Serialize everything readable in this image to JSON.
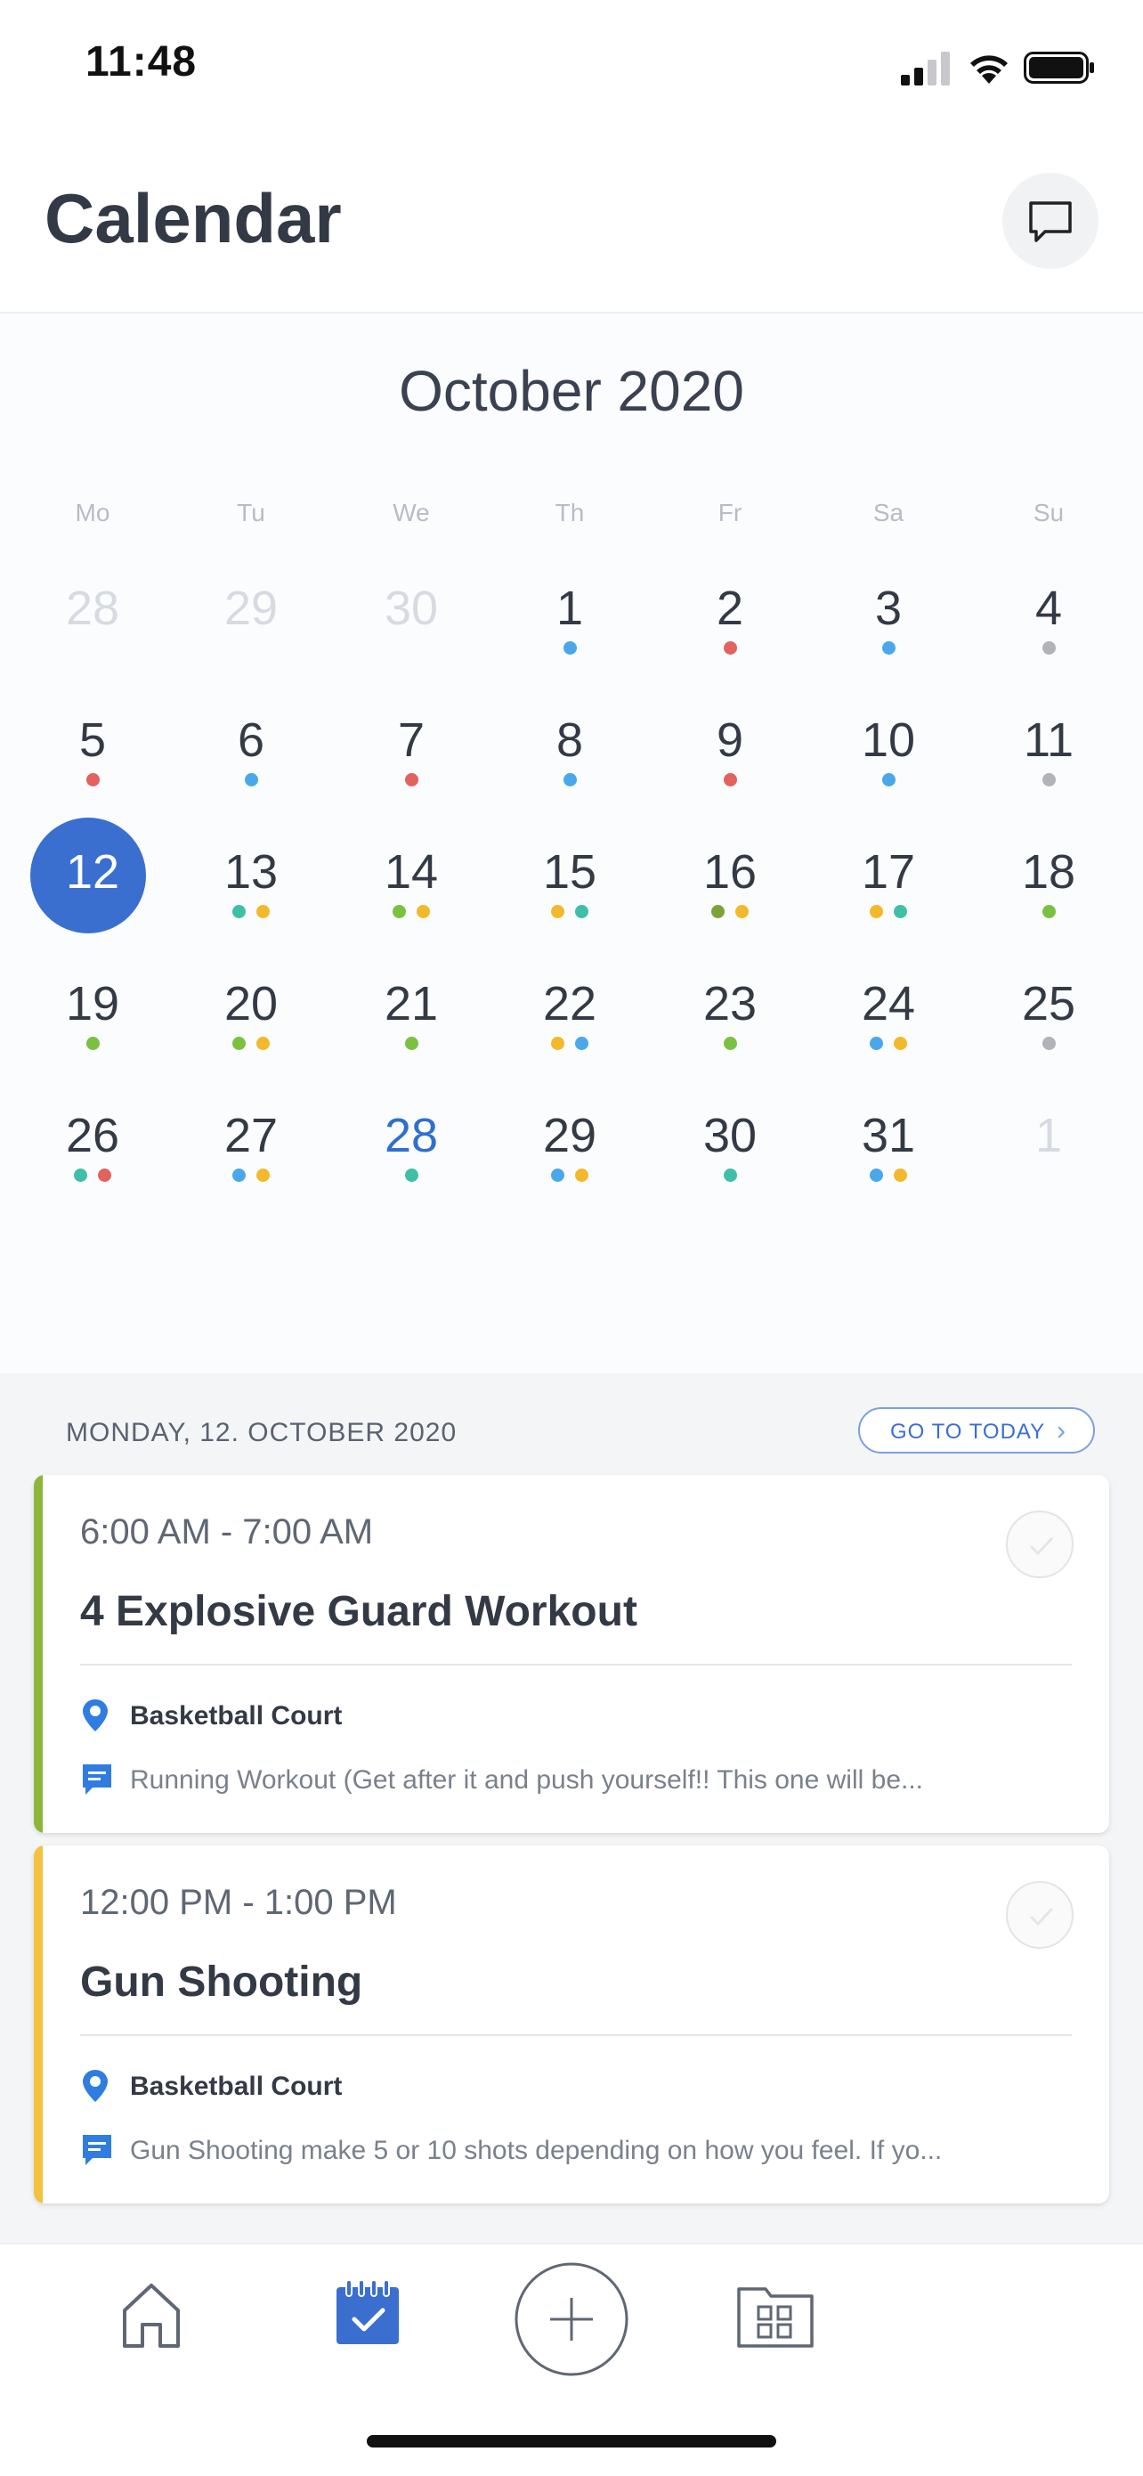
{
  "status_bar": {
    "time": "11:48"
  },
  "header": {
    "title": "Calendar",
    "chat_icon": "chat-bubble-icon"
  },
  "calendar": {
    "month_title": "October 2020",
    "weekdays": [
      "Mo",
      "Tu",
      "We",
      "Th",
      "Fr",
      "Sa",
      "Su"
    ],
    "weeks": [
      [
        {
          "d": "28",
          "muted": true,
          "dots": []
        },
        {
          "d": "29",
          "muted": true,
          "dots": []
        },
        {
          "d": "30",
          "muted": true,
          "dots": []
        },
        {
          "d": "1",
          "dots": [
            "#4aa8ea"
          ]
        },
        {
          "d": "2",
          "dots": [
            "#e2625e"
          ]
        },
        {
          "d": "3",
          "dots": [
            "#4aa8ea"
          ]
        },
        {
          "d": "4",
          "dots": [
            "#b0b3b8"
          ]
        }
      ],
      [
        {
          "d": "5",
          "dots": [
            "#e2625e"
          ]
        },
        {
          "d": "6",
          "dots": [
            "#4aa8ea"
          ]
        },
        {
          "d": "7",
          "dots": [
            "#e2625e"
          ]
        },
        {
          "d": "8",
          "dots": [
            "#4aa8ea"
          ]
        },
        {
          "d": "9",
          "dots": [
            "#e2625e"
          ]
        },
        {
          "d": "10",
          "dots": [
            "#4aa8ea"
          ]
        },
        {
          "d": "11",
          "dots": [
            "#b0b3b8"
          ]
        }
      ],
      [
        {
          "d": "12",
          "selected": true,
          "dots": []
        },
        {
          "d": "13",
          "dots": [
            "#3fbfa8",
            "#f2b92c"
          ]
        },
        {
          "d": "14",
          "dots": [
            "#7ac142",
            "#f2b92c"
          ]
        },
        {
          "d": "15",
          "dots": [
            "#f2b92c",
            "#3fbfa8"
          ]
        },
        {
          "d": "16",
          "dots": [
            "#7ba33a",
            "#f2b92c"
          ]
        },
        {
          "d": "17",
          "dots": [
            "#f2b92c",
            "#3fbfa8"
          ]
        },
        {
          "d": "18",
          "dots": [
            "#7ac142"
          ]
        }
      ],
      [
        {
          "d": "19",
          "dots": [
            "#7ac142"
          ]
        },
        {
          "d": "20",
          "dots": [
            "#7ac142",
            "#f2b92c"
          ]
        },
        {
          "d": "21",
          "dots": [
            "#7ac142"
          ]
        },
        {
          "d": "22",
          "dots": [
            "#f2b92c",
            "#4aa8ea"
          ]
        },
        {
          "d": "23",
          "dots": [
            "#7ac142"
          ]
        },
        {
          "d": "24",
          "dots": [
            "#4aa8ea",
            "#f2b92c"
          ]
        },
        {
          "d": "25",
          "dots": [
            "#b0b3b8"
          ]
        }
      ],
      [
        {
          "d": "26",
          "dots": [
            "#3fbfa8",
            "#e2625e"
          ]
        },
        {
          "d": "27",
          "dots": [
            "#4aa8ea",
            "#f2b92c"
          ]
        },
        {
          "d": "28",
          "blue": true,
          "dots": [
            "#3fbfa8"
          ]
        },
        {
          "d": "29",
          "dots": [
            "#4aa8ea",
            "#f2b92c"
          ]
        },
        {
          "d": "30",
          "dots": [
            "#3fbfa8"
          ]
        },
        {
          "d": "31",
          "dots": [
            "#4aa8ea",
            "#f2b92c"
          ]
        },
        {
          "d": "1",
          "muted": true,
          "dots": []
        }
      ]
    ]
  },
  "agenda": {
    "date_label": "MONDAY, 12. OCTOBER 2020",
    "go_today_label": "GO TO TODAY",
    "events": [
      {
        "time": "6:00 AM - 7:00 AM",
        "title": "4 Explosive Guard Workout",
        "location": "Basketball Court",
        "note": "Running Workout  (Get after it and push yourself!!  This one will be...",
        "accent": "#8db53b"
      },
      {
        "time": "12:00 PM - 1:00 PM",
        "title": "Gun Shooting",
        "location": "Basketball Court",
        "note": "Gun Shooting make 5 or 10 shots depending on how you feel.  If yo...",
        "accent": "#f2c240"
      }
    ]
  },
  "tabbar": {
    "items": [
      "home-icon",
      "calendar-check-icon",
      "add-icon",
      "folder-grid-icon"
    ],
    "active": "calendar-check-icon"
  },
  "colors": {
    "accent": "#3a6fd0",
    "text": "#333a45"
  }
}
